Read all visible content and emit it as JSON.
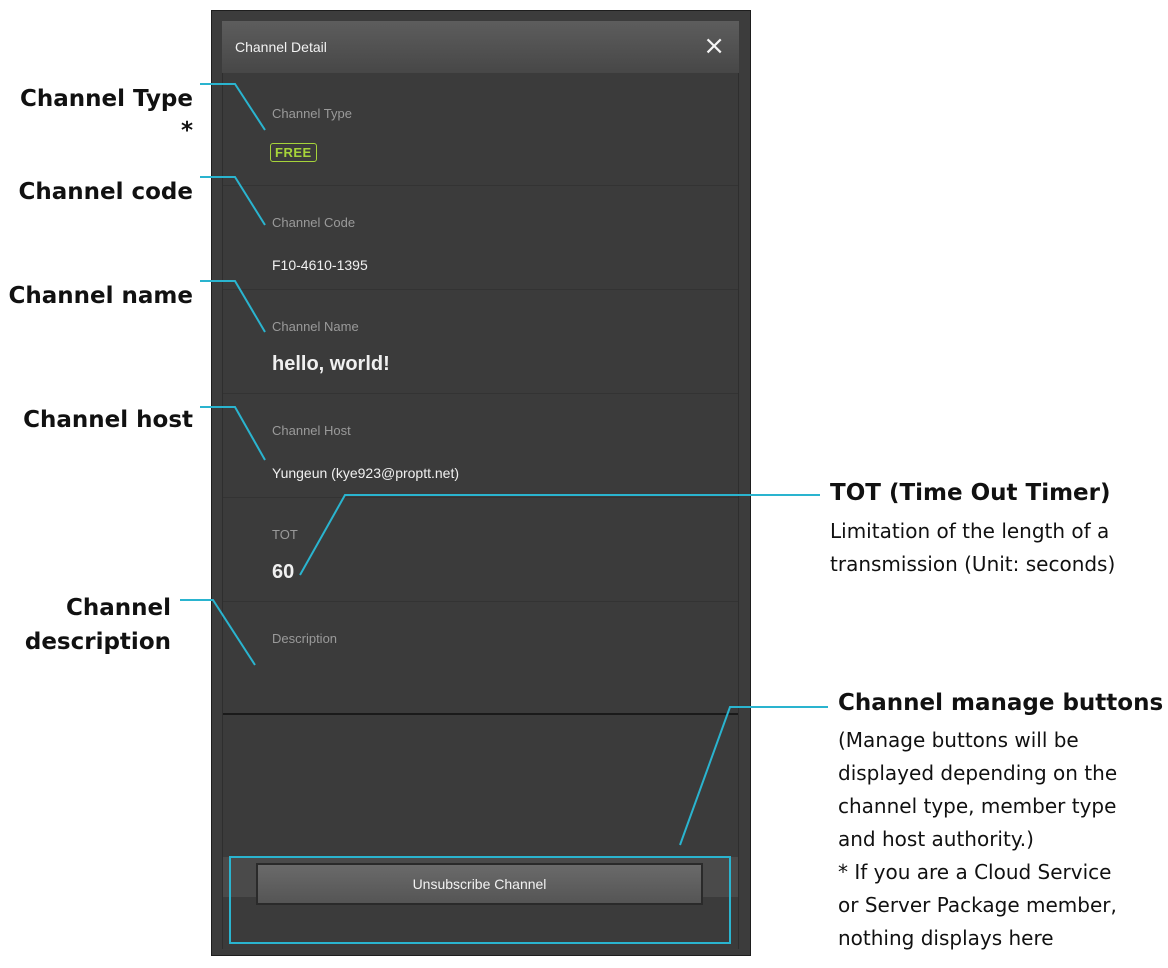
{
  "dialog": {
    "title": "Channel Detail",
    "close_icon": "×",
    "fields": {
      "type_label": "Channel Type",
      "type_badge": "FREE",
      "code_label": "Channel Code",
      "code_value": "F10-4610-1395",
      "name_label": "Channel Name",
      "name_value": "hello, world!",
      "host_label": "Channel Host",
      "host_value": "Yungeun (kye923@proptt.net)",
      "tot_label": "TOT",
      "tot_value": "60",
      "desc_label": "Description"
    },
    "button": "Unsubscribe Channel"
  },
  "annotations": {
    "channel_type": "Channel Type *",
    "channel_code": "Channel code",
    "channel_name": "Channel name",
    "channel_host": "Channel host",
    "channel_desc_1": "Channel",
    "channel_desc_2": "description",
    "tot_title": "TOT (Time Out Timer)",
    "tot_body_1": "Limitation of the length of a",
    "tot_body_2": "transmission (Unit: seconds)",
    "manage_title": "Channel manage buttons",
    "manage_body_1": "(Manage buttons will be",
    "manage_body_2": "displayed depending on the",
    "manage_body_3": "channel type, member type",
    "manage_body_4": "and host authority.)",
    "manage_body_5": "* If you are a Cloud Service",
    "manage_body_6": "or Server Package member,",
    "manage_body_7": "nothing displays here"
  },
  "colors": {
    "accent_line": "#2ab4cf",
    "badge_green": "#a6d43a",
    "panel": "#3b3b3b"
  }
}
